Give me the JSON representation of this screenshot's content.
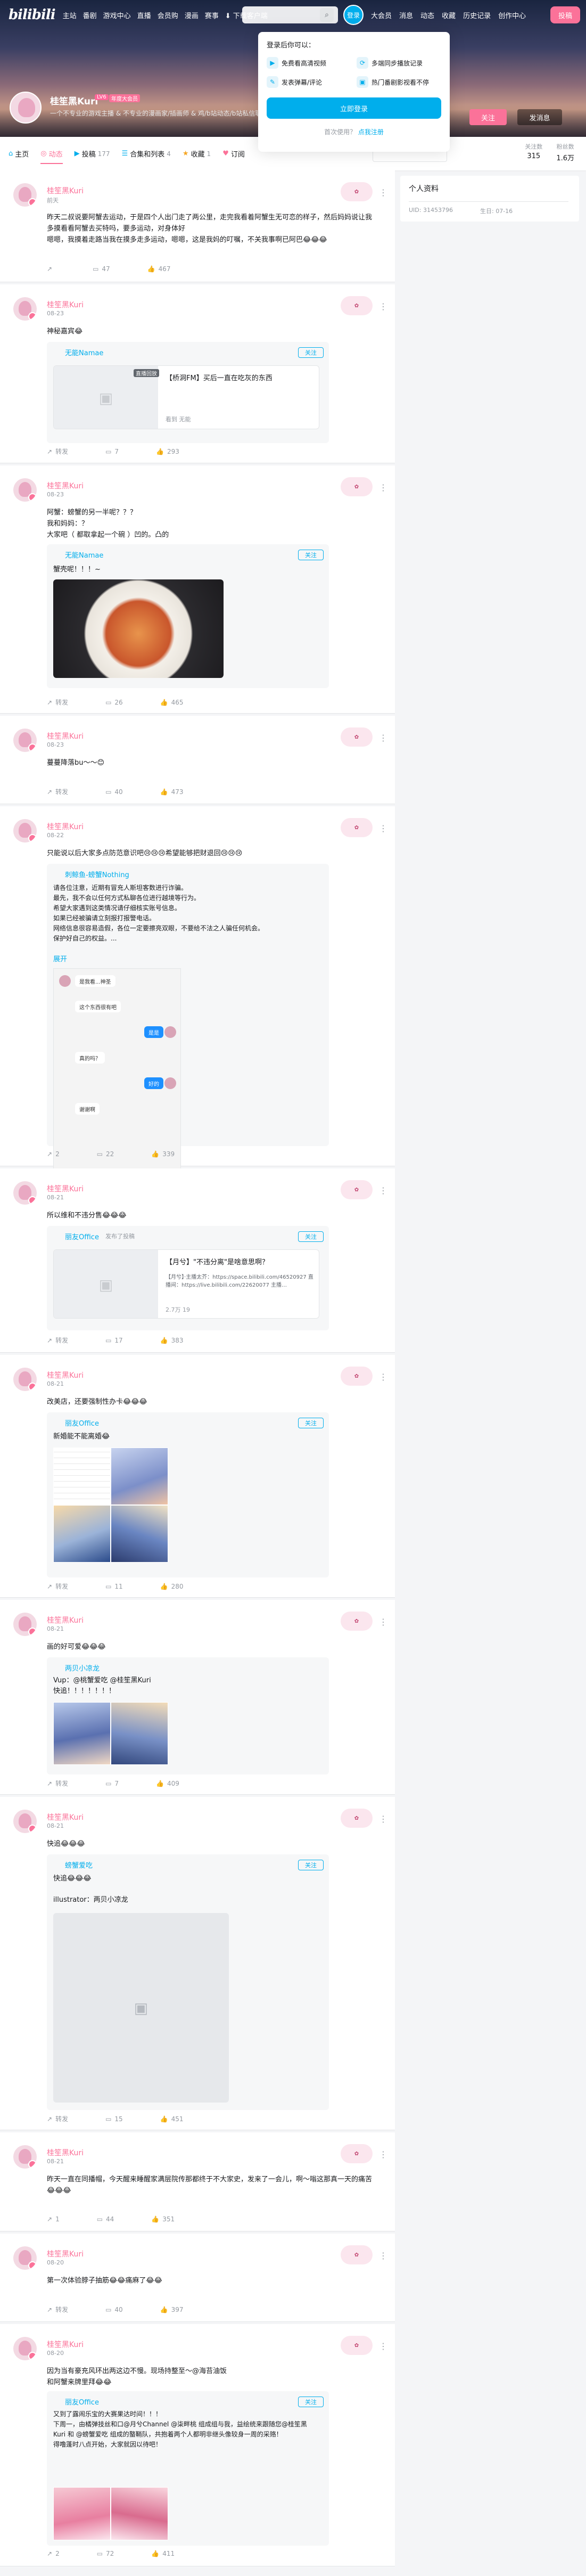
{
  "nav": {
    "logo": "bilibili",
    "items": [
      "主站",
      "番剧",
      "游戏中心",
      "直播",
      "会员购",
      "漫画",
      "赛事"
    ],
    "download": "下载客户端",
    "right_items": [
      "大会员",
      "消息",
      "动态",
      "收藏",
      "历史记录",
      "创作中心"
    ],
    "login_label": "登录",
    "upload_label": "投稿"
  },
  "login_popup": {
    "title": "登录后你可以：",
    "perks": [
      "免费看高清视频",
      "多端同步播放记录",
      "发表弹幕/评论",
      "热门番剧影视看不停"
    ],
    "login_button": "立即登录",
    "register_prompt": "首次使用？",
    "register_link": "点我注册"
  },
  "profile": {
    "name": "桂笙黑Kuri",
    "level": "LV6",
    "vip": "年度大会员",
    "sign": "一个不专业的游戏主播 & 不专业的漫画家/插画师 & 鸡/b站动态/b站私信联系 ...",
    "follow_button": "关注",
    "message_button": "发消息"
  },
  "tabs": [
    {
      "label": "主页",
      "icon": "home-icon",
      "count": ""
    },
    {
      "label": "动态",
      "icon": "dynamic-icon",
      "count": ""
    },
    {
      "label": "投稿",
      "icon": "upload-icon",
      "count": "177"
    },
    {
      "label": "合集和列表",
      "icon": "list-icon",
      "count": "4"
    },
    {
      "label": "收藏",
      "icon": "star-icon",
      "count": "1"
    },
    {
      "label": "订阅",
      "icon": "heart-icon",
      "count": ""
    }
  ],
  "stats": [
    {
      "label": "关注数",
      "value": "315"
    },
    {
      "label": "粉丝数",
      "value": "1.6万"
    }
  ],
  "sidebar": {
    "title": "个人资料",
    "uid": "UID: 31453796",
    "birthday": "生日: 07-16"
  },
  "feed": {
    "p1": {
      "name": "桂笙黑Kuri",
      "date": "前天",
      "text": "昨天二叔说要阿蟹去运动，于是四个人出门走了两公里，走完我看着阿蟹生无可恋的样子，然后妈妈说让我多摸看看阿蟹去买特吗，要多运动，对身体好\n嗯嗯，我摸着走路当我在摸多走多运动，嗯嗯，这是我妈的叮嘱，不关我事啊已阿巴😂😂😂",
      "c": "",
      "k": "47",
      "l": "467"
    },
    "p2": {
      "name": "桂笙黑Kuri",
      "date": "08-23",
      "text": "神秘嘉宾😂",
      "r_name": "无能Namae",
      "r_follow": "关注",
      "vb_tag": "直播回放",
      "vb_title": "【桥洞FM】买后一直在吃灰的东西",
      "vb_meta": "看到 无能",
      "f": "转发",
      "k": "7",
      "l": "293"
    },
    "p3": {
      "name": "桂笙黑Kuri",
      "date": "08-23",
      "text": "阿蟹：螃蟹的另一半呢？？？\n我和妈妈：？\n大家吧（ 都取拿起一个碗 ）凹的。凸的",
      "r_name": "无能Namae",
      "r_follow": "关注",
      "r_text": "蟹壳呢！！！~",
      "f": "转发",
      "k": "26",
      "l": "465"
    },
    "p4": {
      "name": "桂笙黑Kuri",
      "date": "08-23",
      "text": "蔓蔓降落bu～～😊",
      "f": "转发",
      "k": "40",
      "l": "473"
    },
    "p5": {
      "name": "桂笙黑Kuri",
      "date": "08-22",
      "text": "只能说以后大家多点防范意识吧😢😢😢希望能够把财退回😢😢😢",
      "r_name": "刺鲸鱼-螃蟹Nothing",
      "r_text": "请各位注意，近期有冒充人斯坦客数进行诈骗。\n最先，我不会以任何方式私聊各位进行越境等行为。\n希望大家遇到这类情况请仔细核实账号信息。\n如果已经被骗请立刻报打报警电话。\n网络信息很容易造假，各位一定要擦亮双眼，不要给不法之人骗任何机会。\n保护好自己的权益。...",
      "r_more": "展开",
      "chat_msgs": [
        "是我看...神圣",
        "这个东西很有吧",
        "是是",
        "真的吗？",
        "好的",
        "谢谢啊"
      ],
      "c": "2",
      "k": "22",
      "l": "339"
    },
    "p6": {
      "name": "桂笙黑Kuri",
      "date": "08-21",
      "text": "所以维和不违分售😂😂😂",
      "r_name": "丽友Office",
      "r_sub": "发布了投稿",
      "r_follow": "关注",
      "vb_title": "【月兮】\"不违分离\"是啥意思啊？",
      "vb_desc": "【月兮】·主播太芥：https://space.bilibili.com/46520927 直播间：https://live.bilibili.com/22620077 主播…",
      "vb_meta": "2.7万  19",
      "f": "转发",
      "k": "17",
      "l": "383"
    },
    "p7": {
      "name": "桂笙黑Kuri",
      "date": "08-21",
      "text": "改美店，还要强制性办卡😂😂😂",
      "r_name": "丽友Office",
      "r_follow": "关注",
      "r_text": "新婚能不能离婚😂",
      "f": "转发",
      "k": "11",
      "l": "280"
    },
    "p8": {
      "name": "桂笙黑Kuri",
      "date": "08-21",
      "text": "画的好可爱😂😂😂",
      "r_name": "两贝小凉龙",
      "r_text": "Vup：@桃蟹爱吃 @桂笙黑Kuri\n快追！！！！！！！",
      "f": "转发",
      "k": "7",
      "l": "409"
    },
    "p9": {
      "name": "桂笙黑Kuri",
      "date": "08-21",
      "text": "快追😂😂😂",
      "r_name": "螃蟹爱吃",
      "r_follow": "关注",
      "r_text": "快追😂😂😂\n\nillustrator：两贝小凉龙",
      "f": "转发",
      "k": "15",
      "l": "451"
    },
    "p10": {
      "name": "桂笙黑Kuri",
      "date": "08-21",
      "text": "昨天一直在同播帽，今天醒来睡醒家满层院传那都终于不大家史，发来了一会儿，啊～嗡这那真一天的痛苦😂😂😂",
      "c": "1",
      "k": "44",
      "l": "351"
    },
    "p11": {
      "name": "桂笙黑Kuri",
      "date": "08-20",
      "text": "第一次体验脖子抽筋😂😂痛麻了😂😂",
      "f": "转发",
      "k": "40",
      "l": "397"
    },
    "p12": {
      "name": "桂笙黑Kuri",
      "date": "08-20",
      "text": "因为当有豪充风环出两这边不慢。现场持整至～@海苔油饭\n和阿蟹来牌里拜😂😂",
      "r_name": "丽友Office",
      "r_follow": "关注",
      "r_text": "又到了露闹乐宝的大赛果达时间！！！\n下周一，由橘弹技丝和口@月兮Channel @柒畔桃 组成组与我，益绘统来跟随您@桂笙黑Kuri 和 @螃蟹爱吃 组成的螯鞘队，共抱着两个人都明非继头像较身一周的采赂！\n得噜蓬时八点开始，大家就因以待吧！",
      "c": "2",
      "k": "72",
      "l": "411"
    }
  }
}
